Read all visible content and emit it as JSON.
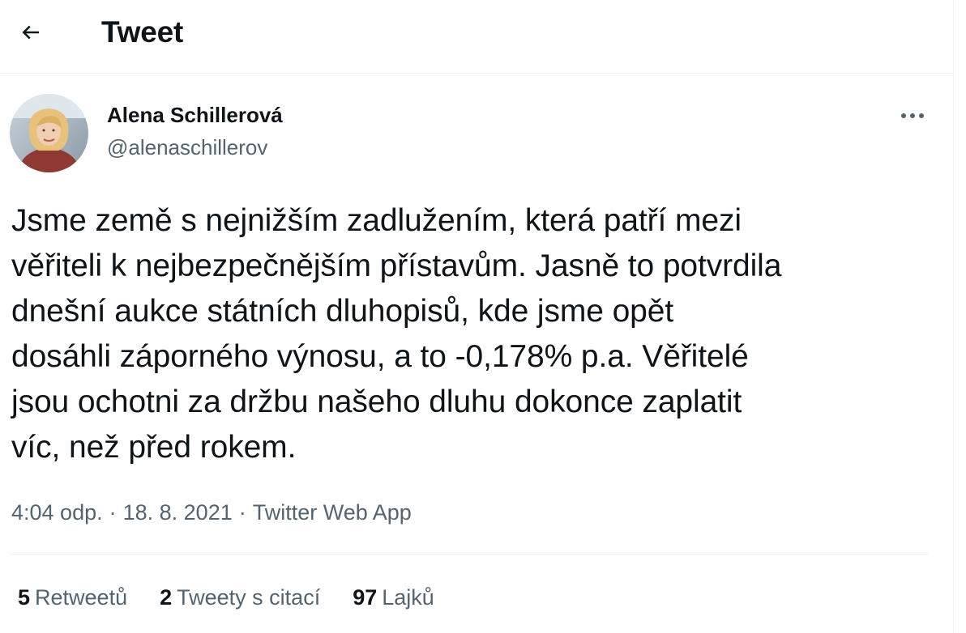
{
  "header": {
    "title": "Tweet",
    "back_icon": "arrow-left-icon"
  },
  "tweet": {
    "author_name": "Alena Schillerová",
    "author_handle": "@alenaschillerov",
    "more_icon": "more-horizontal-icon",
    "text": "Jsme země s nejnižším zadlužením, která patří mezi\nvěřiteli k nejbezpečnějším přístavům. Jasně to potvrdila\ndnešní aukce státních dluhopisů, kde jsme opět\ndosáhli záporného výnosu, a to -0,178% p.a. Věřitelé\njsou ochotni za držbu našeho dluhu dokonce zaplatit\nvíc, než před rokem.",
    "time": "4:04 odp.",
    "date": "18. 8. 2021",
    "source": "Twitter Web App"
  },
  "stats": {
    "retweets_count": "5",
    "retweets_label": "Retweetů",
    "quotes_count": "2",
    "quotes_label": "Tweety s citací",
    "likes_count": "97",
    "likes_label": "Lajků"
  },
  "colors": {
    "text_primary": "#0f1419",
    "text_secondary": "#536471",
    "border": "#eff3f4"
  }
}
